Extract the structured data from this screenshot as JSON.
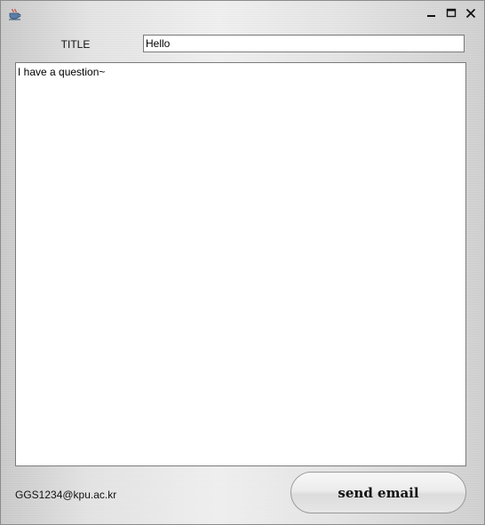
{
  "window": {
    "icon": "java-cup-icon",
    "controls": {
      "minimize": "minimize-icon",
      "maximize": "maximize-icon",
      "close": "close-icon"
    }
  },
  "form": {
    "title_label": "TITLE",
    "title_value": "Hello",
    "body_value": "I have a question~"
  },
  "footer": {
    "email": "GGS1234@kpu.ac.kr",
    "send_label": "send email"
  },
  "colors": {
    "field_border": "#7a7a7a",
    "field_background": "#ffffff"
  }
}
